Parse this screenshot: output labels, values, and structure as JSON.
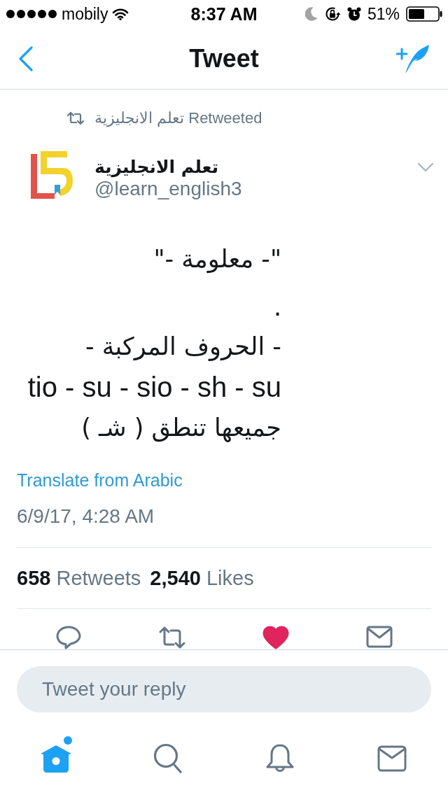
{
  "status_bar": {
    "carrier": "mobily",
    "time": "8:37 AM",
    "battery": "51%"
  },
  "nav_bar": {
    "title": "Tweet"
  },
  "tweet": {
    "retweeted_by": "تعلم الانجليزية Retweeted",
    "author": {
      "name": "تعلم الانجليزية",
      "handle": "@learn_english3"
    },
    "paragraphs": [
      [
        "\"- معلومة -\""
      ],
      [
        ".",
        "- الحروف المركبة -",
        "tio - su - sio - sh - su",
        "جميعها تنطق ( شـ )"
      ]
    ],
    "translate_link": "Translate from Arabic",
    "timestamp": "6/9/17, 4:28 AM",
    "stats": [
      {
        "count": "658",
        "label": "Retweets"
      },
      {
        "count": "2,540",
        "label": "Likes"
      }
    ],
    "actions": [
      {
        "kind": "reply",
        "on": false
      },
      {
        "kind": "retweet",
        "on": false
      },
      {
        "kind": "like",
        "on": true
      },
      {
        "kind": "message",
        "on": false
      }
    ]
  },
  "reply_field": {
    "placeholder": "Tweet your reply"
  },
  "tab_bar": [
    {
      "kind": "home",
      "selected": true,
      "badge": true
    },
    {
      "kind": "search",
      "selected": false,
      "badge": false
    },
    {
      "kind": "notifications",
      "selected": false,
      "badge": false
    },
    {
      "kind": "messages",
      "selected": false,
      "badge": false
    }
  ]
}
